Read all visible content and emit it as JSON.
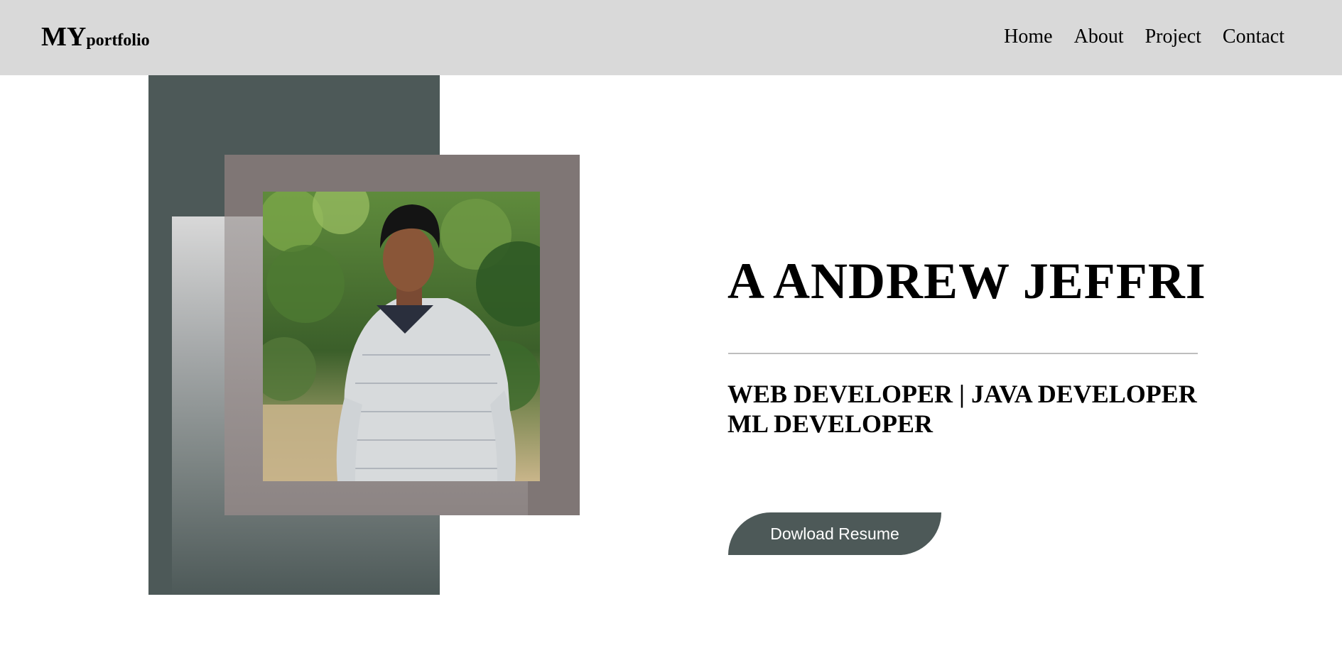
{
  "header": {
    "logo_main": "MY",
    "logo_sub": "portfolio",
    "nav": [
      {
        "label": "Home"
      },
      {
        "label": "About"
      },
      {
        "label": "Project"
      },
      {
        "label": "Contact"
      }
    ]
  },
  "hero": {
    "name": "A ANDREW JEFFRI",
    "roles_line1": "WEB DEVELOPER | JAVA DEVELOPER",
    "roles_line2": "ML DEVELOPER",
    "resume_button": "Dowload Resume"
  },
  "colors": {
    "nav_bg": "#d9d9d9",
    "accent_dark": "#4d5958",
    "frame": "#7f7675",
    "button_text": "#ffffff"
  },
  "icons": {
    "profile_photo": "person-portrait-image"
  }
}
